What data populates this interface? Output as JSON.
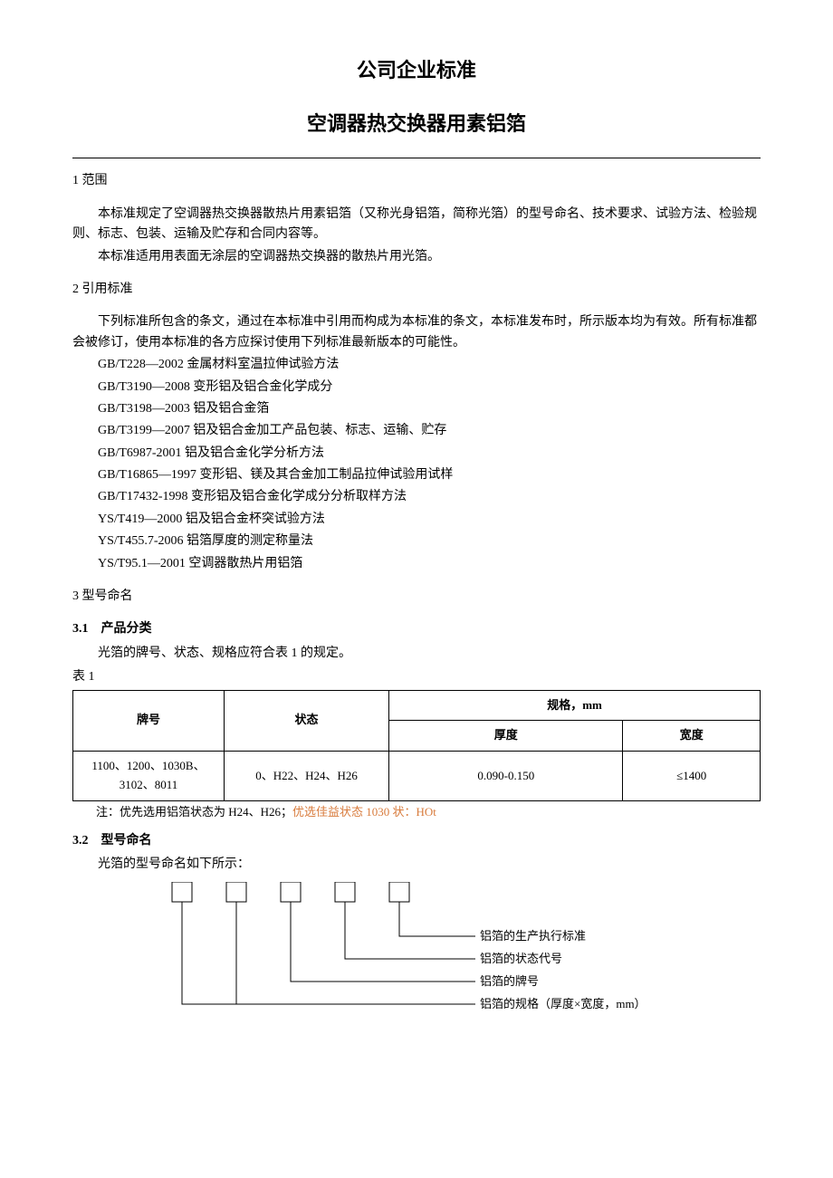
{
  "titleMain": "公司企业标准",
  "titleSub": "空调器热交换器用素铝箔",
  "section1": {
    "heading": "1 范围",
    "p1": "本标准规定了空调器热交换器散热片用素铝箔（又称光身铝箔，简称光箔）的型号命名、技术要求、试验方法、检验规则、标志、包装、运输及贮存和合同内容等。",
    "p2": "本标准适用用表面无涂层的空调器热交换器的散热片用光箔。"
  },
  "section2": {
    "heading": "2 引用标准",
    "intro": "下列标准所包含的条文，通过在本标准中引用而构成为本标准的条文，本标准发布时，所示版本均为有效。所有标准都会被修订，使用本标准的各方应探讨使用下列标准最新版本的可能性。",
    "standards": [
      "GB/T228—2002 金属材料室温拉伸试验方法",
      "GB/T3190—2008 变形铝及铝合金化学成分",
      "GB/T3198—2003 铝及铝合金箔",
      "GB/T3199—2007 铝及铝合金加工产品包装、标志、运输、贮存",
      "GB/T6987-2001 铝及铝合金化学分析方法",
      "GB/T16865—1997 变形铝、镁及其合金加工制品拉伸试验用试样",
      "GB/T17432-1998 变形铝及铝合金化学成分分析取样方法",
      "YS/T419—2000 铝及铝合金杯突试验方法",
      "YS/T455.7-2006 铝箔厚度的测定称量法",
      "YS/T95.1—2001 空调器散热片用铝箔"
    ]
  },
  "section3": {
    "heading": "3 型号命名",
    "sub31": {
      "heading": "3.1　产品分类",
      "p": "光箔的牌号、状态、规格应符合表 1 的规定。"
    },
    "tableCaption": "表 1",
    "table": {
      "headers": {
        "grade": "牌号",
        "state": "状态",
        "spec": "规格，mm",
        "thickness": "厚度",
        "width": "宽度"
      },
      "row": {
        "grade": "1100、1200、1030B、3102、8011",
        "state": "0、H22、H24、H26",
        "thickness": "0.090-0.150",
        "width": "≤1400"
      }
    },
    "tableNote": {
      "black": "注：优先选用铝箔状态为 H24、H26；",
      "red": "优选佳益状态 1030 状：HOt"
    },
    "sub32": {
      "heading": "3.2　型号命名",
      "p": "光箔的型号命名如下所示：",
      "labels": {
        "l1": "铝箔的生产执行标准",
        "l2": "铝箔的状态代号",
        "l3": "铝箔的牌号",
        "l4": "铝箔的规格（厚度×宽度，mm）"
      }
    }
  }
}
